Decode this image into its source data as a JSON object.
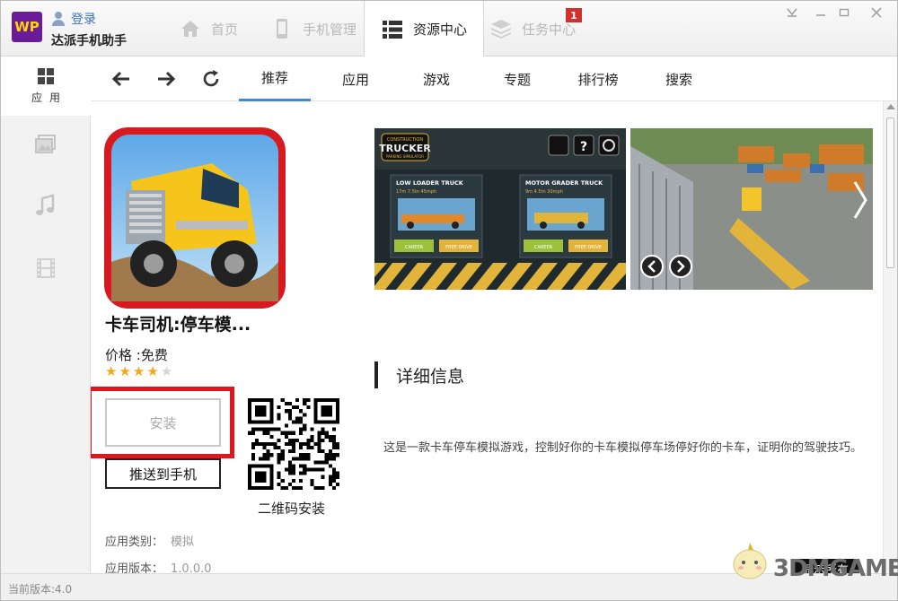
{
  "titlebar": {
    "logo_text": "WP",
    "login_label": "登录",
    "app_name": "达派手机助手",
    "tabs": [
      {
        "label": "首页",
        "icon": "home-icon"
      },
      {
        "label": "手机管理",
        "icon": "phone-icon"
      },
      {
        "label": "资源中心",
        "icon": "list-icon",
        "active": true
      },
      {
        "label": "任务中心",
        "icon": "layers-icon"
      }
    ],
    "task_badge": "1"
  },
  "sidebar": {
    "items": [
      {
        "label": "应用",
        "icon": "apps-grid-icon",
        "active": true
      },
      {
        "label": "",
        "icon": "image-icon"
      },
      {
        "label": "",
        "icon": "music-icon"
      },
      {
        "label": "",
        "icon": "film-icon"
      }
    ]
  },
  "nav": {
    "tabs": [
      {
        "label": "推荐",
        "active": true
      },
      {
        "label": "应用"
      },
      {
        "label": "游戏"
      },
      {
        "label": "专题"
      },
      {
        "label": "排行榜"
      },
      {
        "label": "搜索"
      }
    ]
  },
  "app": {
    "title": "卡车司机:停车模...",
    "price": "价格 :免费",
    "rating": 4,
    "rating_max": 5,
    "install_label": "安装",
    "push_label": "推送到手机",
    "qr_label": "二维码安装",
    "category_label": "应用类别：",
    "category_value": "模拟",
    "version_label": "应用版本：",
    "version_value": "1.0.0.0"
  },
  "screenshots": {
    "game_title_top": "CONSTRUCTION",
    "game_title": "TRUCKER",
    "game_subtitle": "PARKING SIMULATOR",
    "panel1_title": "LOW LOADER TRUCK",
    "panel1_stats": "17m  7.5tn  45mph",
    "panel2_title": "MOTOR GRADER TRUCK",
    "panel2_stats": "9m  4.5tn  30mph",
    "btn_career": "CAREER",
    "btn_free": "FREE DRIVE"
  },
  "details": {
    "heading": "详细信息",
    "description": "这是一款卡车停车模拟游戏，控制好你的卡车模拟停车场停好你的卡车，证明你的驾驶技巧。",
    "show_all": "显示所有"
  },
  "status": {
    "version_text": "当前版本:4.0"
  },
  "watermark": {
    "text": "3DMGAME"
  },
  "colors": {
    "accent": "#3d8bd8",
    "highlight_red": "#e0161e",
    "star": "#f0a81e",
    "logo_bg": "#6a1b9a"
  }
}
